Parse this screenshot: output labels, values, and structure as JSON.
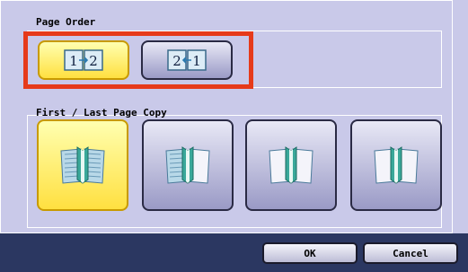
{
  "sections": {
    "page_order": {
      "label": "Page Order"
    },
    "first_last_page_copy": {
      "label": "First / Last Page Copy"
    }
  },
  "page_order_options": [
    {
      "id": "order-12",
      "glyph_left": "1",
      "glyph_right": "2",
      "arrow": "→",
      "selected": true
    },
    {
      "id": "order-21",
      "glyph_left": "2",
      "glyph_right": "1",
      "arrow": "←",
      "selected": false
    }
  ],
  "copy_options": [
    {
      "id": "copy-1",
      "icon": "open-book-both-pages-icon",
      "selected": true
    },
    {
      "id": "copy-2",
      "icon": "open-book-left-page-icon",
      "selected": false
    },
    {
      "id": "copy-3",
      "icon": "open-book-center-icon",
      "selected": false
    },
    {
      "id": "copy-4",
      "icon": "open-book-right-page-icon",
      "selected": false
    }
  ],
  "footer": {
    "ok_label": "OK",
    "cancel_label": "Cancel"
  },
  "colors": {
    "panel_bg": "#c9c9e9",
    "selected_bg": "#ffe040",
    "highlight_border": "#e63a1a",
    "footer_bg": "#2b3761"
  }
}
